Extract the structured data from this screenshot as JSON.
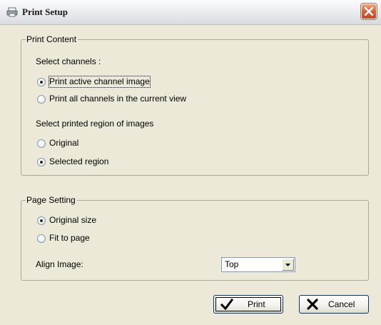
{
  "window": {
    "title": "Print Setup"
  },
  "print_content": {
    "legend": "Print Content",
    "channels_label": "Select channels :",
    "channel_options": [
      {
        "label": "Print active channel image",
        "checked": true
      },
      {
        "label": "Print all channels in the current view",
        "checked": false
      }
    ],
    "region_label": "Select printed region of images",
    "region_options": [
      {
        "label": "Original",
        "checked": false
      },
      {
        "label": "Selected region",
        "checked": true
      }
    ]
  },
  "page_setting": {
    "legend": "Page Setting",
    "size_options": [
      {
        "label": "Original size",
        "checked": true
      },
      {
        "label": "Fit to page",
        "checked": false
      }
    ],
    "align_label": "Align Image:",
    "align_value": "Top"
  },
  "buttons": {
    "print_label": "Print",
    "cancel_label": "Cancel"
  },
  "icons": {
    "title": "printer-icon",
    "close": "close-icon",
    "print": "checkmark-icon",
    "cancel": "cross-icon",
    "dropdown": "chevron-down-icon"
  },
  "colors": {
    "dialog_background": "#ece9d8",
    "close_button": "#e0623a"
  }
}
